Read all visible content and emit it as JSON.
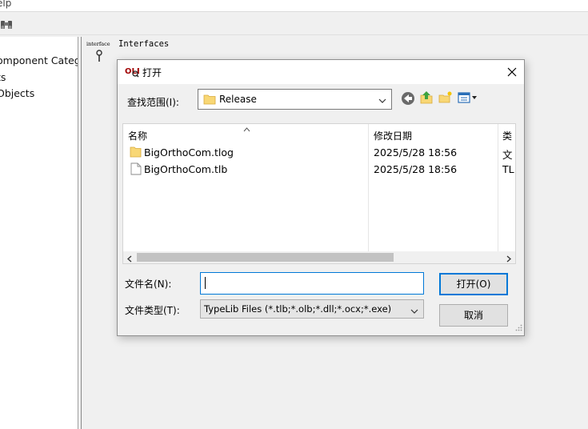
{
  "menubar": {
    "help_label": "elp"
  },
  "tree": {
    "items": [
      "omponent Categ",
      "ts",
      "Objects"
    ]
  },
  "right_pane": {
    "small_label": "interface",
    "title": "Interfaces"
  },
  "dialog": {
    "title": "打开",
    "look_in_label": "查找范围(I):",
    "look_in_value": "Release",
    "columns": {
      "name": "名称",
      "modified": "修改日期",
      "type": "类"
    },
    "files": [
      {
        "name": "BigOrthoCom.tlog",
        "modified": "2025/5/28 18:56",
        "type": "文",
        "icon": "folder-icon"
      },
      {
        "name": "BigOrthoCom.tlb",
        "modified": "2025/5/28 18:56",
        "type": "TL",
        "icon": "file-icon"
      }
    ],
    "filename_label": "文件名(N):",
    "filename_value": "",
    "filetype_label": "文件类型(T):",
    "filetype_value": "TypeLib Files (*.tlb;*.olb;*.dll;*.ocx;*.exe)",
    "open_button": "打开(O)",
    "cancel_button": "取消"
  },
  "colors": {
    "accent": "#0078d7",
    "folder": "#f8d775"
  }
}
